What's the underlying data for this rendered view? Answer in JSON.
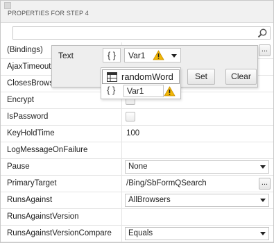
{
  "header": {
    "title": "PROPERTIES FOR STEP 4"
  },
  "search": {
    "placeholder": ""
  },
  "rows": [
    {
      "name": "(Bindings)",
      "value": ""
    },
    {
      "name": "AjaxTimeout",
      "value": ""
    },
    {
      "name": "ClosesBrowser",
      "value": ""
    },
    {
      "name": "Encrypt",
      "value": ""
    },
    {
      "name": "IsPassword",
      "value": ""
    },
    {
      "name": "KeyHoldTime",
      "value": "100"
    },
    {
      "name": "LogMessageOnFailure",
      "value": ""
    },
    {
      "name": "Pause",
      "value": "None"
    },
    {
      "name": "PrimaryTarget",
      "value": "/Bing/SbFormQSearch"
    },
    {
      "name": "RunsAgainst",
      "value": "AllBrowsers"
    },
    {
      "name": "RunsAgainstVersion",
      "value": ""
    },
    {
      "name": "RunsAgainstVersionCompare",
      "value": "Equals"
    }
  ],
  "binding_popup": {
    "label": "Text",
    "brace": "{ }",
    "selected_variable": "Var1",
    "set_label": "Set",
    "clear_label": "Clear",
    "options": [
      {
        "label": "randomWord",
        "icon": "table-icon"
      },
      {
        "label": "Var1",
        "icon": "braces-icon"
      }
    ]
  },
  "ellipsis": "...",
  "colors": {
    "warning": "#f2b705",
    "border": "#c8c8c8",
    "header_bg": "#f1f1f1"
  }
}
